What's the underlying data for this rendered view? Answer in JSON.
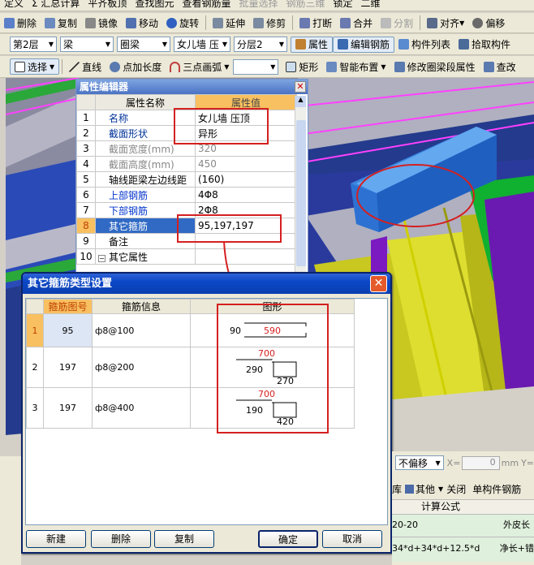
{
  "toolbar1": {
    "items": [
      "定义",
      "Σ 汇总计算",
      "平齐板顶",
      "查找图元",
      "查看钢筋量",
      "批量选择",
      "钢筋三维",
      "锁定",
      "二维"
    ]
  },
  "toolbar2": {
    "items": [
      "删除",
      "复制",
      "镜像",
      "移动",
      "旋转",
      "延伸",
      "修剪",
      "打断",
      "合并",
      "分割",
      "对齐",
      "偏移"
    ]
  },
  "toolbar3": {
    "floor": "第2层",
    "type": "梁",
    "subtype": "圈梁",
    "name": "女儿墙 压",
    "layer": "分层2",
    "attr": "属性",
    "edit": "编辑钢筋",
    "list": "构件列表",
    "pick": "拾取构件"
  },
  "toolbar4": {
    "select": "选择",
    "line": "直线",
    "point": "点加长度",
    "arc": "三点画弧",
    "rect": "矩形",
    "smart": "智能布置",
    "modify": "修改圈梁段属性",
    "check": "查改"
  },
  "prop_editor": {
    "title": "属性编辑器",
    "col_name": "属性名称",
    "col_value": "属性值",
    "rows": [
      {
        "n": "1",
        "name": "名称",
        "value": "女儿墙 压顶"
      },
      {
        "n": "2",
        "name": "截面形状",
        "value": "异形"
      },
      {
        "n": "3",
        "name": "截面宽度(mm)",
        "value": "320"
      },
      {
        "n": "4",
        "name": "截面高度(mm)",
        "value": "450"
      },
      {
        "n": "5",
        "name": "轴线距梁左边线距",
        "value": "(160)"
      },
      {
        "n": "6",
        "name": "上部钢筋",
        "value": "4Φ8"
      },
      {
        "n": "7",
        "name": "下部钢筋",
        "value": "2Φ8"
      },
      {
        "n": "8",
        "name": "其它箍筋",
        "value": "95,197,197"
      },
      {
        "n": "9",
        "name": "备注",
        "value": ""
      },
      {
        "n": "10",
        "name": "其它属性",
        "value": ""
      }
    ]
  },
  "dialog": {
    "title": "其它箍筋类型设置",
    "col_no": "箍筋图号",
    "col_info": "箍筋信息",
    "col_shape": "图形",
    "rows": [
      {
        "n": "1",
        "no": "95",
        "info": "ф8@100",
        "left": "90",
        "top": "590",
        "right": ""
      },
      {
        "n": "2",
        "no": "197",
        "info": "ф8@200",
        "left": "290",
        "top": "700",
        "right": "270"
      },
      {
        "n": "3",
        "no": "197",
        "info": "ф8@400",
        "left": "190",
        "top": "700",
        "right": "420"
      }
    ],
    "buttons": {
      "new": "新建",
      "delete": "删除",
      "copy": "复制",
      "ok": "确定",
      "cancel": "取消"
    }
  },
  "bottom": {
    "offset": "不偏移",
    "x_label": "X=",
    "x_val": "0",
    "mm": "mm",
    "y_label": "Y=",
    "lib": "库",
    "other": "其他",
    "close": "关闭",
    "single": "单构件钢筋",
    "formula": "计算公式",
    "f1": "20-20",
    "f2": "34*d+34*d+12.5*d",
    "r1": "外皮长",
    "r2": "净长+错"
  },
  "colors": {
    "accent": "#2f63d8",
    "red": "#d42020",
    "beam": "#3a86e0"
  }
}
